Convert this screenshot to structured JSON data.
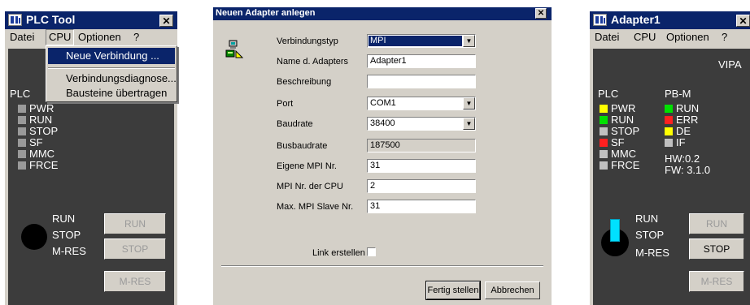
{
  "left_window": {
    "title": "PLC Tool",
    "close_glyph": "✕",
    "menu": [
      "Datei",
      "CPU",
      "Optionen",
      "?"
    ],
    "dropdown": [
      "Neue Verbindung ...",
      "Verbindungsdiagnose...",
      "Bausteine übertragen"
    ],
    "section_label": "PLC",
    "leds": [
      {
        "label": "PWR",
        "color": "#9a9a9a"
      },
      {
        "label": "RUN",
        "color": "#9a9a9a"
      },
      {
        "label": "STOP",
        "color": "#9a9a9a"
      },
      {
        "label": "SF",
        "color": "#9a9a9a"
      },
      {
        "label": "MMC",
        "color": "#9a9a9a"
      },
      {
        "label": "FRCE",
        "color": "#9a9a9a"
      }
    ],
    "switch_labels": [
      "RUN",
      "STOP",
      "M-RES"
    ],
    "buttons": [
      "RUN",
      "STOP",
      "M-RES"
    ]
  },
  "dialog": {
    "title": "Neuen Adapter anlegen",
    "close_glyph": "✕",
    "fields": [
      {
        "label": "Verbindungstyp",
        "value": "MPI",
        "kind": "combo-hl"
      },
      {
        "label": "Name d. Adapters",
        "value": "Adapter1",
        "kind": "text"
      },
      {
        "label": "Beschreibung",
        "value": "",
        "kind": "text"
      },
      {
        "label": "Port",
        "value": "COM1",
        "kind": "combo"
      },
      {
        "label": "Baudrate",
        "value": "38400",
        "kind": "combo"
      },
      {
        "label": "Busbaudrate",
        "value": "187500",
        "kind": "readonly"
      },
      {
        "label": "Eigene MPI Nr.",
        "value": "31",
        "kind": "text"
      },
      {
        "label": "MPI Nr. der CPU",
        "value": "2",
        "kind": "text"
      },
      {
        "label": "Max. MPI Slave Nr.",
        "value": "31",
        "kind": "text"
      }
    ],
    "checkbox_label": "Link erstellen",
    "ok_button": "Fertig stellen",
    "cancel_button": "Abbrechen"
  },
  "right_window": {
    "title": "Adapter1",
    "close_glyph": "✕",
    "menu": [
      "Datei",
      "CPU",
      "Optionen",
      "?"
    ],
    "brand": "VIPA",
    "plc_label": "PLC",
    "pbm_label": "PB-M",
    "plc_leds": [
      {
        "label": "PWR",
        "color": "#ffff00"
      },
      {
        "label": "RUN",
        "color": "#00e000"
      },
      {
        "label": "STOP",
        "color": "#c0c0c0"
      },
      {
        "label": "SF",
        "color": "#ff2020"
      },
      {
        "label": "MMC",
        "color": "#c0c0c0"
      },
      {
        "label": "FRCE",
        "color": "#c0c0c0"
      }
    ],
    "pbm_leds": [
      {
        "label": "RUN",
        "color": "#00e000"
      },
      {
        "label": "ERR",
        "color": "#ff2020"
      },
      {
        "label": "DE",
        "color": "#ffff00"
      },
      {
        "label": "IF",
        "color": "#c0c0c0"
      }
    ],
    "hw": "HW:0.2",
    "fw": "FW: 3.1.0",
    "switch_labels": [
      "RUN",
      "STOP",
      "M-RES"
    ],
    "buttons": [
      "RUN",
      "STOP",
      "M-RES"
    ]
  }
}
